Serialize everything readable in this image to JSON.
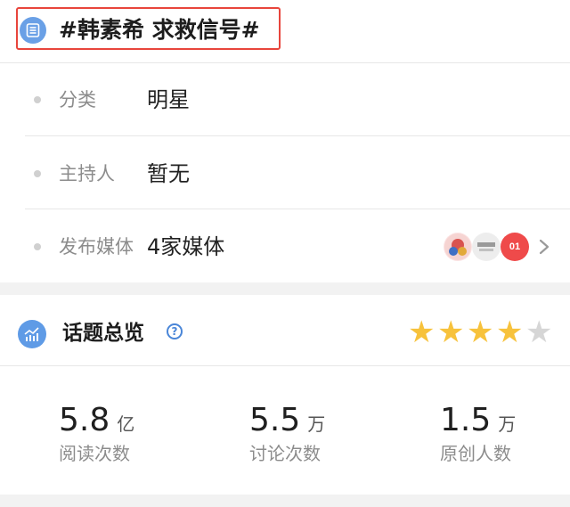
{
  "topic": {
    "title": "#韩素希 求救信号#"
  },
  "info_rows": [
    {
      "label": "分类",
      "value": "明星"
    },
    {
      "label": "主持人",
      "value": "暂无"
    },
    {
      "label": "发布媒体",
      "value": "4家媒体"
    }
  ],
  "media_logos": [
    {
      "icon": "media-logo-1",
      "color": "#d9534f"
    },
    {
      "icon": "media-logo-2",
      "color": "#bcbcbc"
    },
    {
      "icon": "media-logo-3",
      "color": "#ef4a4a",
      "text": "01"
    }
  ],
  "overview": {
    "title": "话题总览",
    "rating": {
      "value": 4,
      "max": 5
    },
    "colors": {
      "star_on": "#f7c23c",
      "star_off": "#d6d6d6"
    }
  },
  "stats": [
    {
      "number": "5.8",
      "unit": "亿",
      "label": "阅读次数"
    },
    {
      "number": "5.5",
      "unit": "万",
      "label": "讨论次数"
    },
    {
      "number": "1.5",
      "unit": "万",
      "label": "原创人数"
    }
  ]
}
